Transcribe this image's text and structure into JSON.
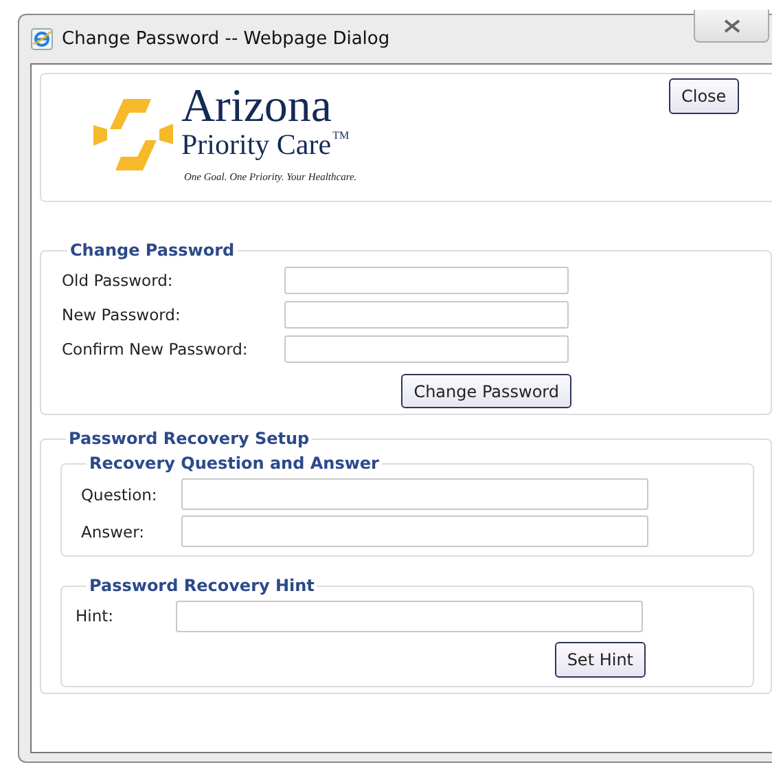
{
  "window": {
    "title": "Change Password -- Webpage Dialog"
  },
  "logo": {
    "name": "Arizona",
    "subname": "Priority Care",
    "trademark": "TM",
    "tagline": "One Goal. One Priority. Your Healthcare."
  },
  "close_button": "Close",
  "sections": [
    {
      "legend": "Change Password",
      "fields": [
        {
          "label": "Old Password:"
        },
        {
          "label": "New Password:"
        },
        {
          "label": "Confirm New Password:"
        }
      ],
      "button": "Change Password"
    },
    {
      "legend": "Password Recovery Setup",
      "groups": [
        {
          "legend": "Recovery Question and Answer",
          "fields": [
            {
              "label": "Question:"
            },
            {
              "label": "Answer:"
            }
          ]
        },
        {
          "legend": "Password Recovery Hint",
          "fields": [
            {
              "label": "Hint:"
            }
          ],
          "button": "Set Hint"
        }
      ]
    }
  ]
}
